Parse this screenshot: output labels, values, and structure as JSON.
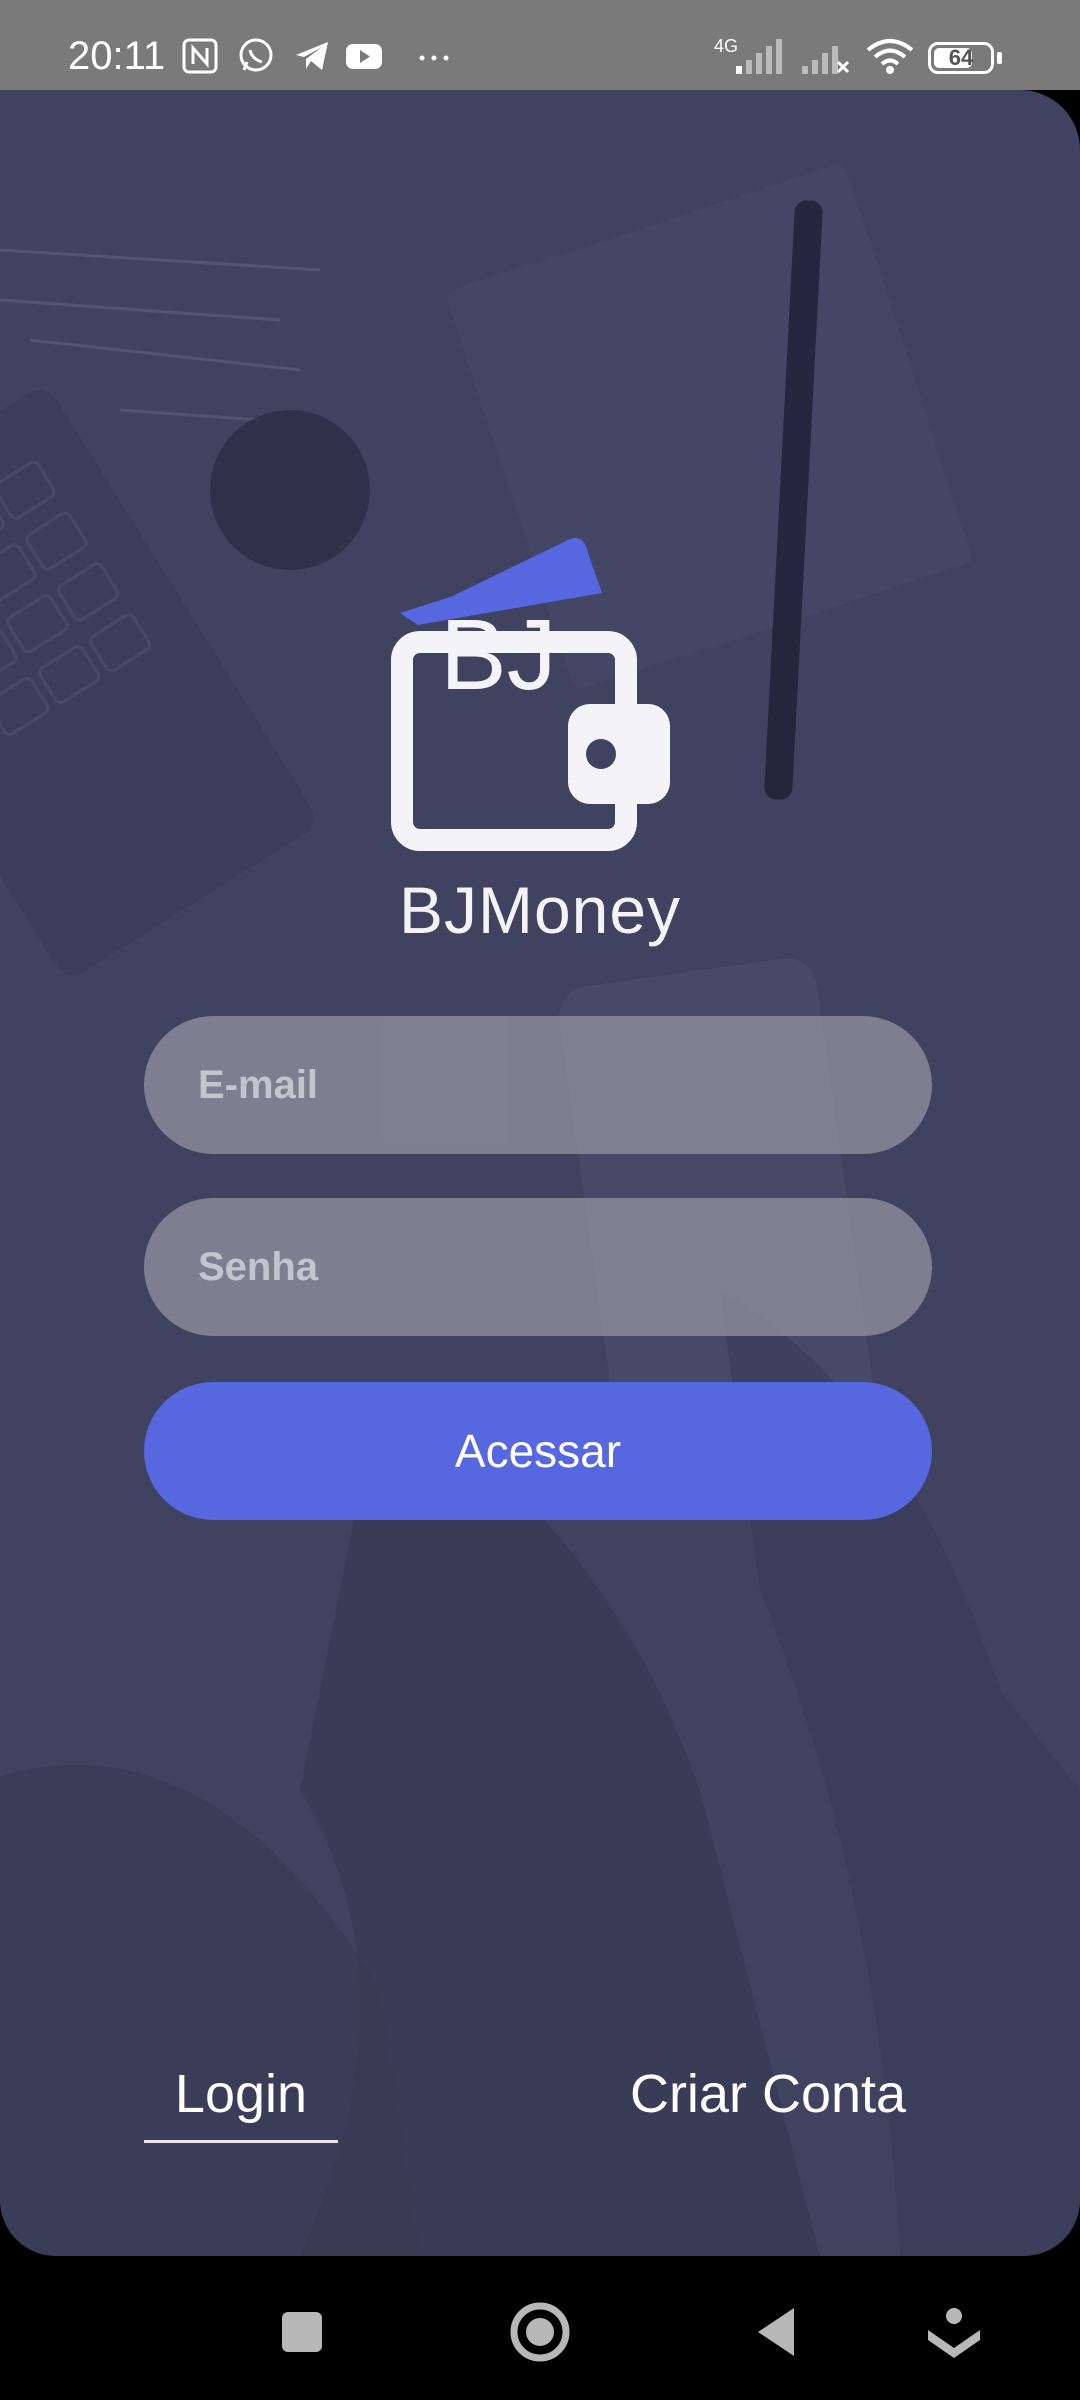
{
  "status_bar": {
    "time": "20:11",
    "network": "4G",
    "battery_level": "64",
    "icons": [
      "nfc-icon",
      "whatsapp-icon",
      "telegram-icon",
      "youtube-icon",
      "more-icon",
      "signal-icon",
      "signal-off-icon",
      "wifi-icon",
      "battery-icon"
    ]
  },
  "logo": {
    "badge_text": "BJ",
    "app_name": "BJMoney"
  },
  "form": {
    "email_placeholder": "E-mail",
    "password_placeholder": "Senha",
    "submit_label": "Acessar"
  },
  "tabs": {
    "login_label": "Login",
    "create_label": "Criar Conta",
    "active": "Login"
  },
  "colors": {
    "overlay": "#3f4360",
    "accent": "#5667df",
    "field_bg": "#9696a2"
  },
  "nav_bar": {
    "buttons": [
      "recent-apps-icon",
      "home-icon",
      "back-icon",
      "assistant-icon"
    ]
  }
}
